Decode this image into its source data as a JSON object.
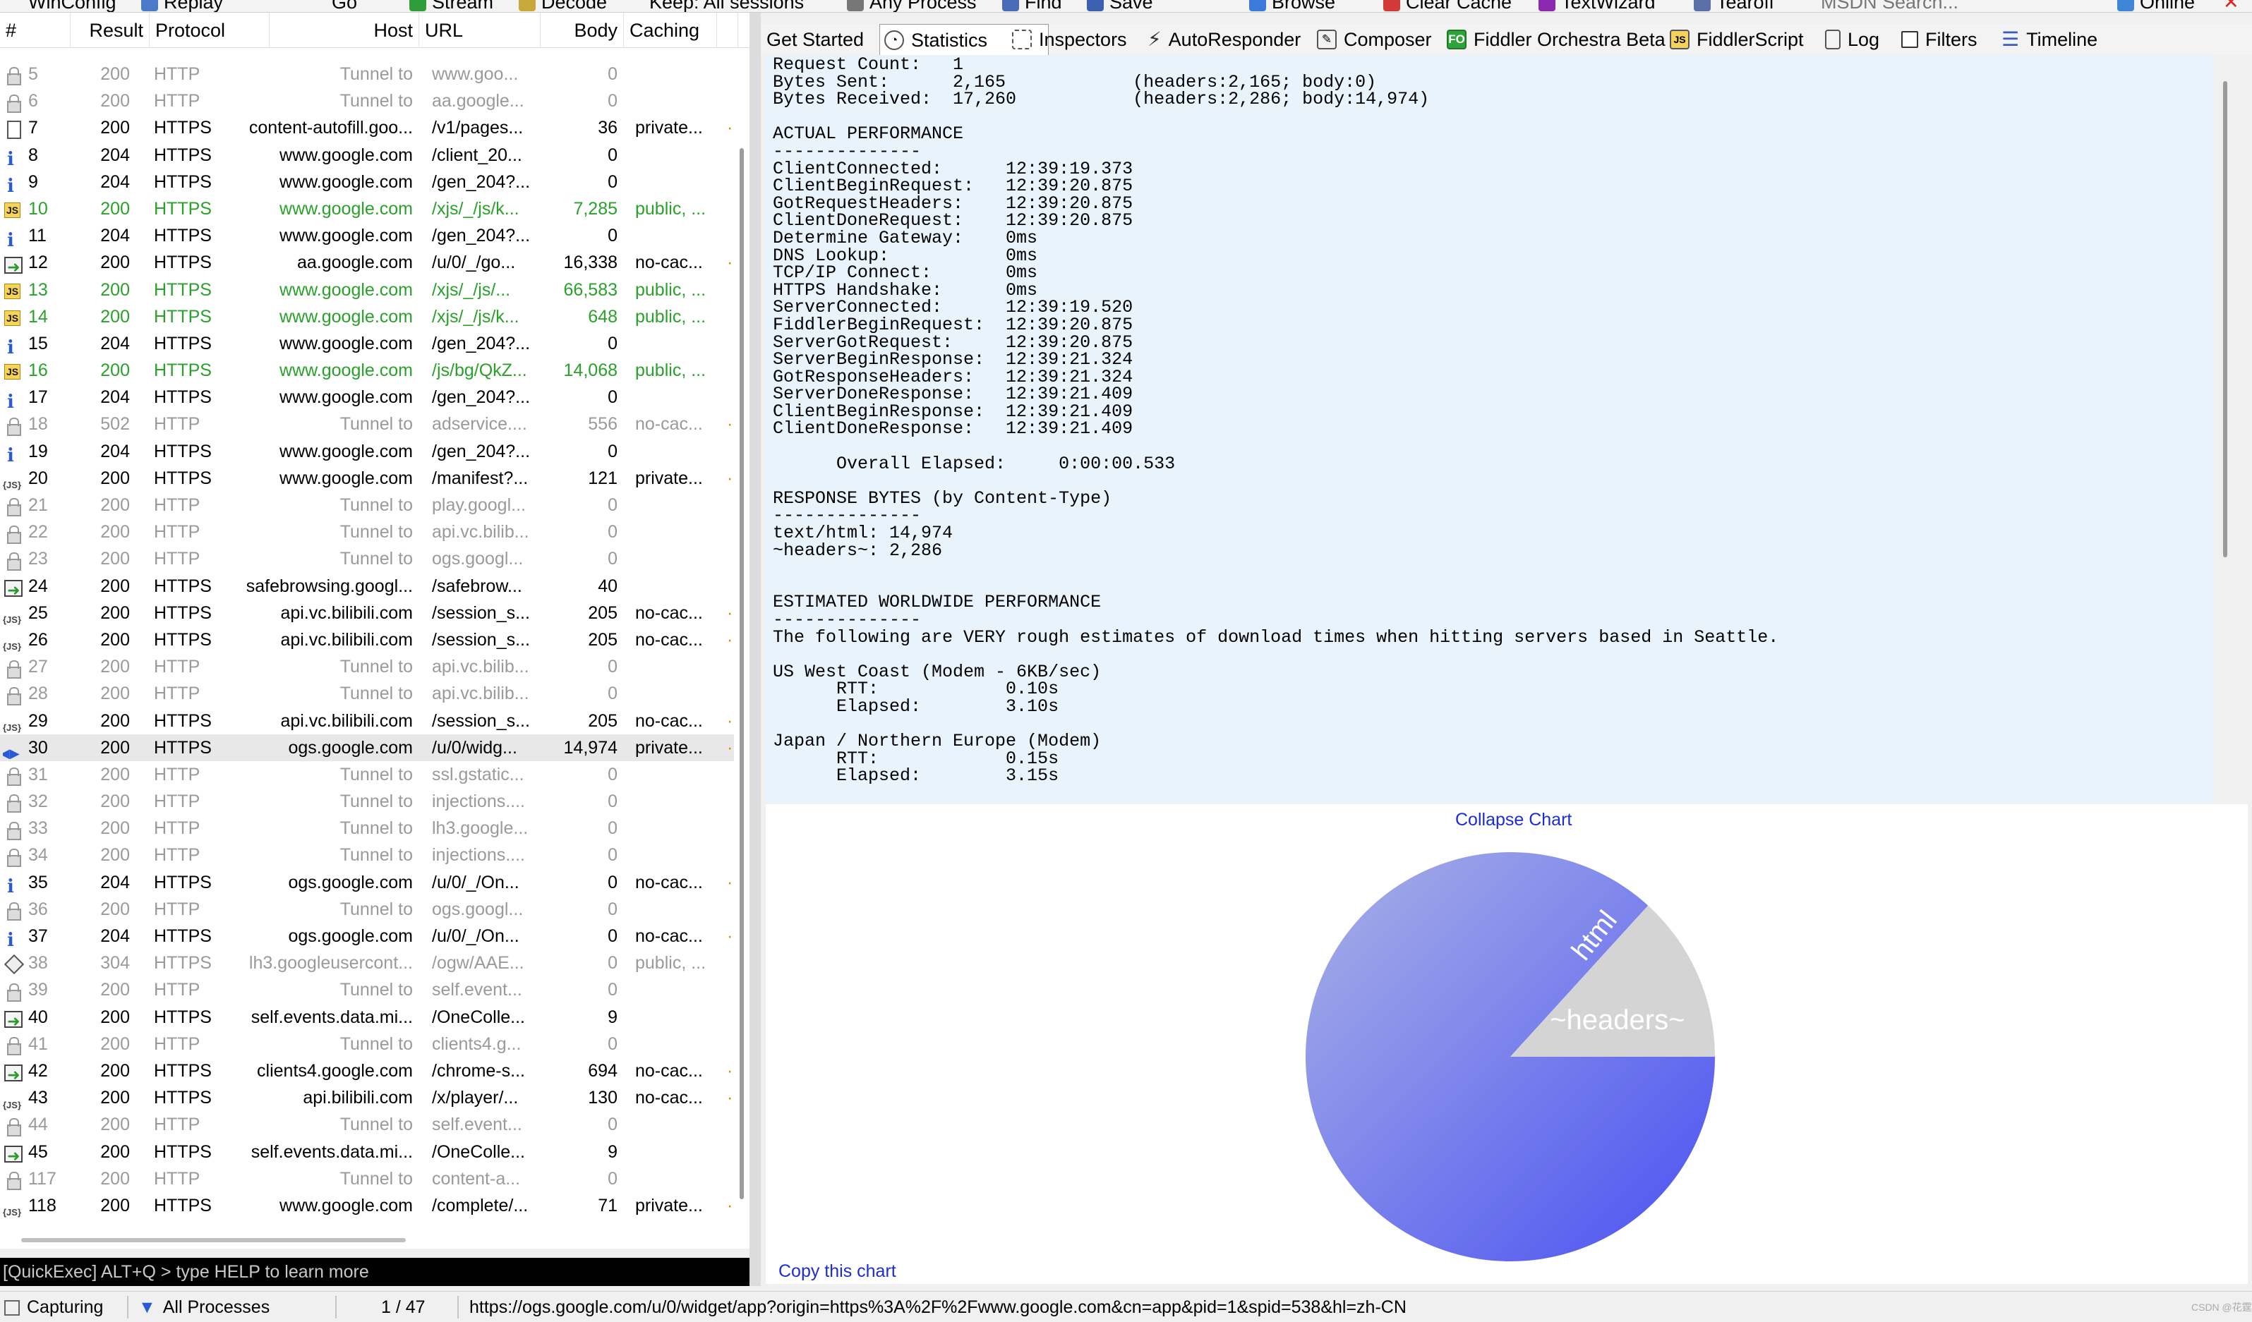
{
  "toolbar": {
    "items": [
      "WinConfig",
      "Replay",
      "Go",
      "Stream",
      "Decode",
      "Keep: All sessions",
      "Any Process",
      "Find",
      "Save",
      "Browse",
      "Clear Cache",
      "TextWizard",
      "Tearoff",
      "MSDN Search...",
      "Online"
    ]
  },
  "columns": {
    "num": "#",
    "result": "Result",
    "protocol": "Protocol",
    "host": "Host",
    "url": "URL",
    "body": "Body",
    "caching": "Caching"
  },
  "sessions": [
    {
      "num": "5",
      "result": "200",
      "protocol": "HTTP",
      "host": "Tunnel to",
      "url": "www.goo...",
      "body": "0",
      "caching": "",
      "icon": "lock",
      "kind": "tunnel"
    },
    {
      "num": "6",
      "result": "200",
      "protocol": "HTTP",
      "host": "Tunnel to",
      "url": "aa.google...",
      "body": "0",
      "caching": "",
      "icon": "lock",
      "kind": "tunnel"
    },
    {
      "num": "7",
      "result": "200",
      "protocol": "HTTPS",
      "host": "content-autofill.goo...",
      "url": "/v1/pages...",
      "body": "36",
      "caching": "private...",
      "icon": "doc",
      "kind": "normal"
    },
    {
      "num": "8",
      "result": "204",
      "protocol": "HTTPS",
      "host": "www.google.com",
      "url": "/client_20...",
      "body": "0",
      "caching": "",
      "icon": "info",
      "kind": "normal"
    },
    {
      "num": "9",
      "result": "204",
      "protocol": "HTTPS",
      "host": "www.google.com",
      "url": "/gen_204?...",
      "body": "0",
      "caching": "",
      "icon": "info",
      "kind": "normal"
    },
    {
      "num": "10",
      "result": "200",
      "protocol": "HTTPS",
      "host": "www.google.com",
      "url": "/xjs/_/js/k...",
      "body": "7,285",
      "caching": "public, ...",
      "icon": "js",
      "kind": "js"
    },
    {
      "num": "11",
      "result": "204",
      "protocol": "HTTPS",
      "host": "www.google.com",
      "url": "/gen_204?...",
      "body": "0",
      "caching": "",
      "icon": "info",
      "kind": "normal"
    },
    {
      "num": "12",
      "result": "200",
      "protocol": "HTTPS",
      "host": "aa.google.com",
      "url": "/u/0/_/go...",
      "body": "16,338",
      "caching": "no-cac...",
      "icon": "arrow",
      "kind": "normal"
    },
    {
      "num": "13",
      "result": "200",
      "protocol": "HTTPS",
      "host": "www.google.com",
      "url": "/xjs/_/js/...",
      "body": "66,583",
      "caching": "public, ...",
      "icon": "js",
      "kind": "js"
    },
    {
      "num": "14",
      "result": "200",
      "protocol": "HTTPS",
      "host": "www.google.com",
      "url": "/xjs/_/js/k...",
      "body": "648",
      "caching": "public, ...",
      "icon": "js",
      "kind": "js"
    },
    {
      "num": "15",
      "result": "204",
      "protocol": "HTTPS",
      "host": "www.google.com",
      "url": "/gen_204?...",
      "body": "0",
      "caching": "",
      "icon": "info",
      "kind": "normal"
    },
    {
      "num": "16",
      "result": "200",
      "protocol": "HTTPS",
      "host": "www.google.com",
      "url": "/js/bg/QkZ...",
      "body": "14,068",
      "caching": "public, ...",
      "icon": "js",
      "kind": "js"
    },
    {
      "num": "17",
      "result": "204",
      "protocol": "HTTPS",
      "host": "www.google.com",
      "url": "/gen_204?...",
      "body": "0",
      "caching": "",
      "icon": "info",
      "kind": "normal"
    },
    {
      "num": "18",
      "result": "502",
      "protocol": "HTTP",
      "host": "Tunnel to",
      "url": "adservice....",
      "body": "556",
      "caching": "no-cac...",
      "icon": "lock",
      "kind": "tunnel"
    },
    {
      "num": "19",
      "result": "204",
      "protocol": "HTTPS",
      "host": "www.google.com",
      "url": "/gen_204?...",
      "body": "0",
      "caching": "",
      "icon": "info",
      "kind": "normal"
    },
    {
      "num": "20",
      "result": "200",
      "protocol": "HTTPS",
      "host": "www.google.com",
      "url": "/manifest?...",
      "body": "121",
      "caching": "private...",
      "icon": "json",
      "kind": "normal"
    },
    {
      "num": "21",
      "result": "200",
      "protocol": "HTTP",
      "host": "Tunnel to",
      "url": "play.googl...",
      "body": "0",
      "caching": "",
      "icon": "lock",
      "kind": "tunnel"
    },
    {
      "num": "22",
      "result": "200",
      "protocol": "HTTP",
      "host": "Tunnel to",
      "url": "api.vc.bilib...",
      "body": "0",
      "caching": "",
      "icon": "lock",
      "kind": "tunnel"
    },
    {
      "num": "23",
      "result": "200",
      "protocol": "HTTP",
      "host": "Tunnel to",
      "url": "ogs.googl...",
      "body": "0",
      "caching": "",
      "icon": "lock",
      "kind": "tunnel"
    },
    {
      "num": "24",
      "result": "200",
      "protocol": "HTTPS",
      "host": "safebrowsing.googl...",
      "url": "/safebrow...",
      "body": "40",
      "caching": "",
      "icon": "arrow",
      "kind": "normal"
    },
    {
      "num": "25",
      "result": "200",
      "protocol": "HTTPS",
      "host": "api.vc.bilibili.com",
      "url": "/session_s...",
      "body": "205",
      "caching": "no-cac...",
      "icon": "json",
      "kind": "normal"
    },
    {
      "num": "26",
      "result": "200",
      "protocol": "HTTPS",
      "host": "api.vc.bilibili.com",
      "url": "/session_s...",
      "body": "205",
      "caching": "no-cac...",
      "icon": "json",
      "kind": "normal"
    },
    {
      "num": "27",
      "result": "200",
      "protocol": "HTTP",
      "host": "Tunnel to",
      "url": "api.vc.bilib...",
      "body": "0",
      "caching": "",
      "icon": "lock",
      "kind": "tunnel"
    },
    {
      "num": "28",
      "result": "200",
      "protocol": "HTTP",
      "host": "Tunnel to",
      "url": "api.vc.bilib...",
      "body": "0",
      "caching": "",
      "icon": "lock",
      "kind": "tunnel"
    },
    {
      "num": "29",
      "result": "200",
      "protocol": "HTTPS",
      "host": "api.vc.bilibili.com",
      "url": "/session_s...",
      "body": "205",
      "caching": "no-cac...",
      "icon": "json",
      "kind": "normal"
    },
    {
      "num": "30",
      "result": "200",
      "protocol": "HTTPS",
      "host": "ogs.google.com",
      "url": "/u/0/widg...",
      "body": "14,974",
      "caching": "private...",
      "icon": "sel",
      "kind": "selected"
    },
    {
      "num": "31",
      "result": "200",
      "protocol": "HTTP",
      "host": "Tunnel to",
      "url": "ssl.gstatic...",
      "body": "0",
      "caching": "",
      "icon": "lock",
      "kind": "tunnel"
    },
    {
      "num": "32",
      "result": "200",
      "protocol": "HTTP",
      "host": "Tunnel to",
      "url": "injections....",
      "body": "0",
      "caching": "",
      "icon": "lock",
      "kind": "tunnel"
    },
    {
      "num": "33",
      "result": "200",
      "protocol": "HTTP",
      "host": "Tunnel to",
      "url": "lh3.google...",
      "body": "0",
      "caching": "",
      "icon": "lock",
      "kind": "tunnel"
    },
    {
      "num": "34",
      "result": "200",
      "protocol": "HTTP",
      "host": "Tunnel to",
      "url": "injections....",
      "body": "0",
      "caching": "",
      "icon": "lock",
      "kind": "tunnel"
    },
    {
      "num": "35",
      "result": "204",
      "protocol": "HTTPS",
      "host": "ogs.google.com",
      "url": "/u/0/_/On...",
      "body": "0",
      "caching": "no-cac...",
      "icon": "info",
      "kind": "normal"
    },
    {
      "num": "36",
      "result": "200",
      "protocol": "HTTP",
      "host": "Tunnel to",
      "url": "ogs.googl...",
      "body": "0",
      "caching": "",
      "icon": "lock",
      "kind": "tunnel"
    },
    {
      "num": "37",
      "result": "204",
      "protocol": "HTTPS",
      "host": "ogs.google.com",
      "url": "/u/0/_/On...",
      "body": "0",
      "caching": "no-cac...",
      "icon": "info",
      "kind": "normal"
    },
    {
      "num": "38",
      "result": "304",
      "protocol": "HTTPS",
      "host": "lh3.googleusercont...",
      "url": "/ogw/AAE...",
      "body": "0",
      "caching": "public, ...",
      "icon": "diamond",
      "kind": "img"
    },
    {
      "num": "39",
      "result": "200",
      "protocol": "HTTP",
      "host": "Tunnel to",
      "url": "self.event...",
      "body": "0",
      "caching": "",
      "icon": "lock",
      "kind": "tunnel"
    },
    {
      "num": "40",
      "result": "200",
      "protocol": "HTTPS",
      "host": "self.events.data.mi...",
      "url": "/OneColle...",
      "body": "9",
      "caching": "",
      "icon": "arrow",
      "kind": "normal"
    },
    {
      "num": "41",
      "result": "200",
      "protocol": "HTTP",
      "host": "Tunnel to",
      "url": "clients4.g...",
      "body": "0",
      "caching": "",
      "icon": "lock",
      "kind": "tunnel"
    },
    {
      "num": "42",
      "result": "200",
      "protocol": "HTTPS",
      "host": "clients4.google.com",
      "url": "/chrome-s...",
      "body": "694",
      "caching": "no-cac...",
      "icon": "arrow",
      "kind": "normal"
    },
    {
      "num": "43",
      "result": "200",
      "protocol": "HTTPS",
      "host": "api.bilibili.com",
      "url": "/x/player/...",
      "body": "130",
      "caching": "no-cac...",
      "icon": "json",
      "kind": "normal"
    },
    {
      "num": "44",
      "result": "200",
      "protocol": "HTTP",
      "host": "Tunnel to",
      "url": "self.event...",
      "body": "0",
      "caching": "",
      "icon": "lock",
      "kind": "tunnel"
    },
    {
      "num": "45",
      "result": "200",
      "protocol": "HTTPS",
      "host": "self.events.data.mi...",
      "url": "/OneColle...",
      "body": "9",
      "caching": "",
      "icon": "arrow",
      "kind": "normal"
    },
    {
      "num": "117",
      "result": "200",
      "protocol": "HTTP",
      "host": "Tunnel to",
      "url": "content-a...",
      "body": "0",
      "caching": "",
      "icon": "lock",
      "kind": "tunnel"
    },
    {
      "num": "118",
      "result": "200",
      "protocol": "HTTPS",
      "host": "www.google.com",
      "url": "/complete/...",
      "body": "71",
      "caching": "private...",
      "icon": "json",
      "kind": "normal"
    }
  ],
  "quickexec": {
    "placeholder": "[QuickExec] ALT+Q > type HELP to learn more"
  },
  "tabs": [
    "Get Started",
    "Statistics",
    "Inspectors",
    "AutoResponder",
    "Composer",
    "Fiddler Orchestra Beta",
    "FiddlerScript",
    "Log",
    "Filters",
    "Timeline"
  ],
  "tab_icons": {
    "fo": "FO",
    "fiddlerscript": "JS"
  },
  "stats_text": "Request Count:   1\nBytes Sent:      2,165            (headers:2,165; body:0)\nBytes Received:  17,260           (headers:2,286; body:14,974)\n\nACTUAL PERFORMANCE\n--------------\nClientConnected:      12:39:19.373\nClientBeginRequest:   12:39:20.875\nGotRequestHeaders:    12:39:20.875\nClientDoneRequest:    12:39:20.875\nDetermine Gateway:    0ms\nDNS Lookup:           0ms\nTCP/IP Connect:       0ms\nHTTPS Handshake:      0ms\nServerConnected:      12:39:19.520\nFiddlerBeginRequest:  12:39:20.875\nServerGotRequest:     12:39:20.875\nServerBeginResponse:  12:39:21.324\nGotResponseHeaders:   12:39:21.324\nServerDoneResponse:   12:39:21.409\nClientBeginResponse:  12:39:21.409\nClientDoneResponse:   12:39:21.409\n\n      Overall Elapsed:     0:00:00.533\n\nRESPONSE BYTES (by Content-Type)\n--------------\ntext/html: 14,974\n~headers~: 2,286\n\n\nESTIMATED WORLDWIDE PERFORMANCE\n--------------\nThe following are VERY rough estimates of download times when hitting servers based in Seattle.\n\nUS West Coast (Modem - 6KB/sec)\n      RTT:            0.10s\n      Elapsed:        3.10s\n\nJapan / Northern Europe (Modem)\n      RTT:            0.15s\n      Elapsed:        3.15s",
  "chart": {
    "collapse_label": "Collapse Chart",
    "copy_label": "Copy this chart"
  },
  "chart_data": {
    "type": "pie",
    "slices": [
      {
        "label": "html",
        "value": 14974,
        "color": "#5a62ef"
      },
      {
        "label": "~headers~",
        "value": 2286,
        "color": "#d4d4d4"
      }
    ]
  },
  "status": {
    "capturing": "Capturing",
    "processes": "All Processes",
    "count": "1 / 47",
    "url": "https://ogs.google.com/u/0/widget/app?origin=https%3A%2F%2Fwww.google.com&cn=app&pid=1&spid=538&hl=zh-CN"
  },
  "watermark": "CSDN @花霆"
}
